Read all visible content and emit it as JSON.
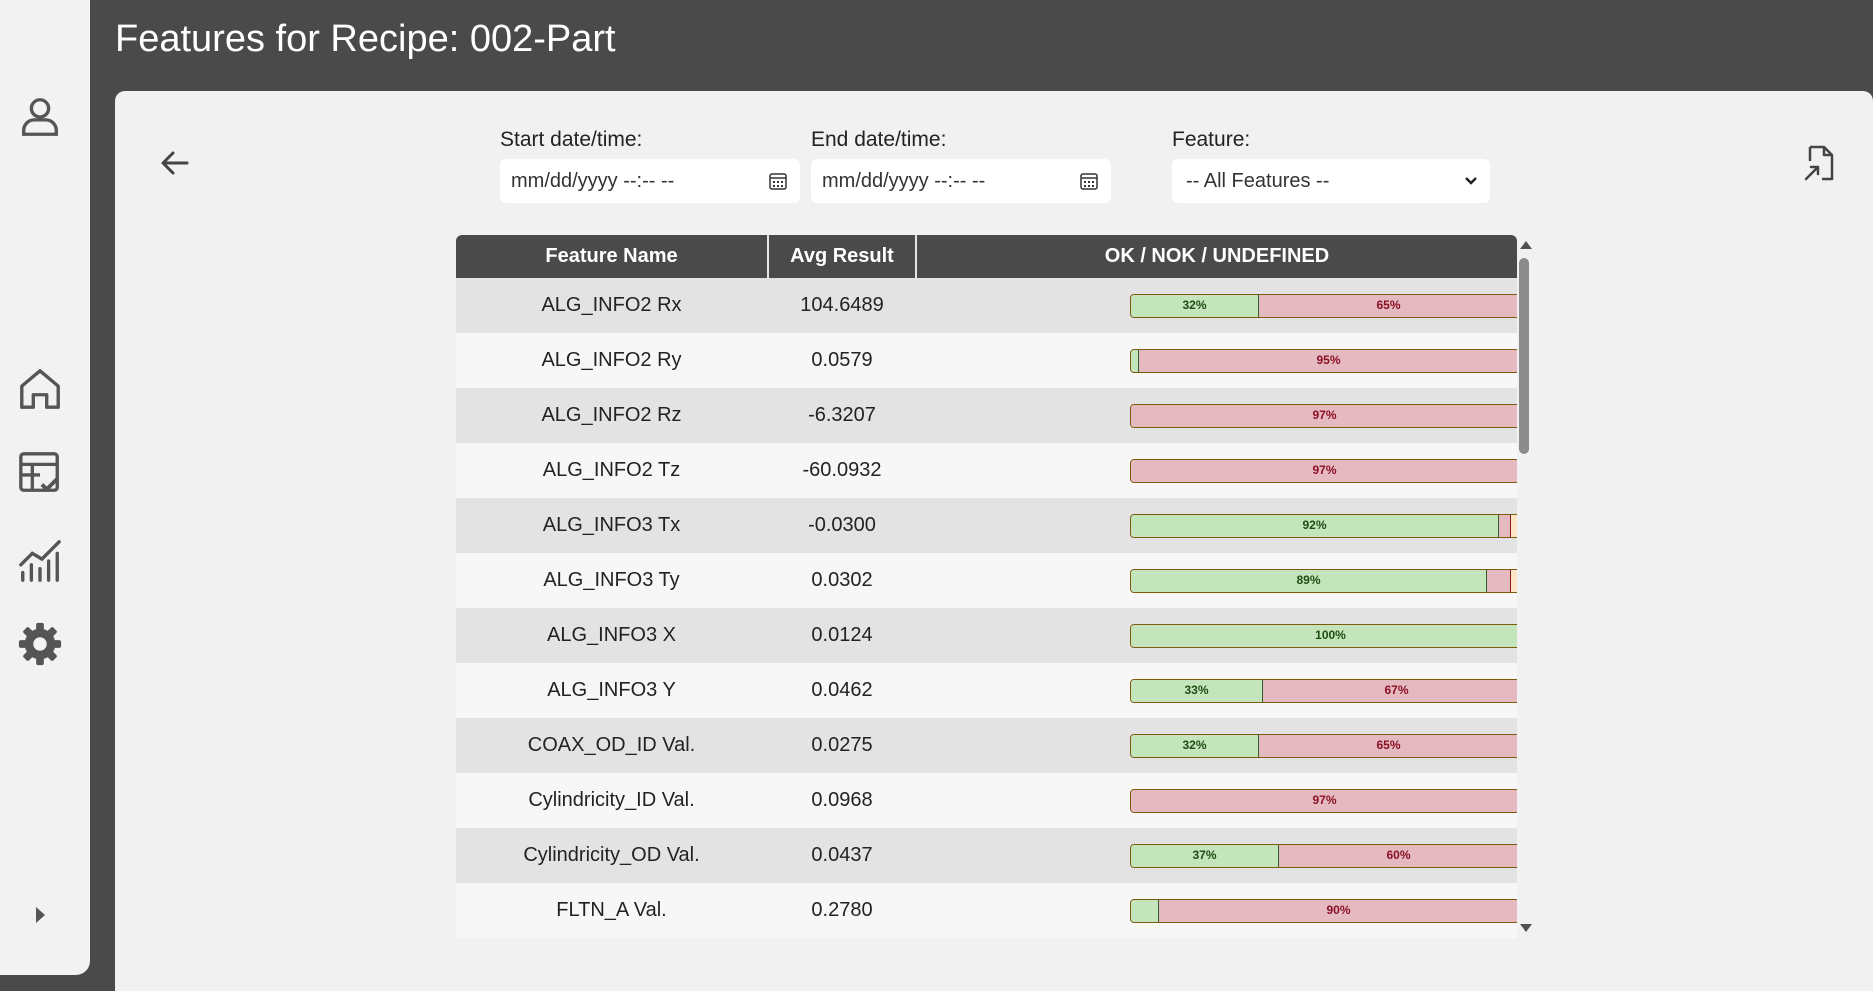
{
  "header": {
    "title": "Features for Recipe: 002-Part"
  },
  "sidebar": {
    "items": [
      {
        "name": "user-icon"
      },
      {
        "name": "home-icon"
      },
      {
        "name": "checklist-icon"
      },
      {
        "name": "chart-icon"
      },
      {
        "name": "settings-icon"
      },
      {
        "name": "expand-arrow-icon"
      }
    ]
  },
  "filters": {
    "start_label": "Start date/time:",
    "start_placeholder": "mm/dd/yyyy --:-- --",
    "end_label": "End date/time:",
    "end_placeholder": "mm/dd/yyyy --:-- --",
    "feature_label": "Feature:",
    "feature_selected": "-- All Features --"
  },
  "table": {
    "headers": [
      "Feature Name",
      "Avg Result",
      "OK / NOK / UNDEFINED"
    ],
    "rows": [
      {
        "name": "ALG_INFO2 Rx",
        "avg": "104.6489",
        "ok": 32,
        "nok": 65,
        "ok_label": "32%",
        "nok_label": "65%"
      },
      {
        "name": "ALG_INFO2 Ry",
        "avg": "0.0579",
        "ok": 2,
        "nok": 95,
        "ok_label": "",
        "nok_label": "95%"
      },
      {
        "name": "ALG_INFO2 Rz",
        "avg": "-6.3207",
        "ok": 0,
        "nok": 97,
        "ok_label": "",
        "nok_label": "97%"
      },
      {
        "name": "ALG_INFO2 Tz",
        "avg": "-60.0932",
        "ok": 0,
        "nok": 97,
        "ok_label": "",
        "nok_label": "97%"
      },
      {
        "name": "ALG_INFO3 Tx",
        "avg": "-0.0300",
        "ok": 92,
        "nok": 3,
        "ok_label": "92%",
        "nok_label": ""
      },
      {
        "name": "ALG_INFO3 Ty",
        "avg": "0.0302",
        "ok": 89,
        "nok": 6,
        "ok_label": "89%",
        "nok_label": ""
      },
      {
        "name": "ALG_INFO3 X",
        "avg": "0.0124",
        "ok": 100,
        "nok": 0,
        "ok_label": "100%",
        "nok_label": ""
      },
      {
        "name": "ALG_INFO3 Y",
        "avg": "0.0462",
        "ok": 33,
        "nok": 67,
        "ok_label": "33%",
        "nok_label": "67%"
      },
      {
        "name": "COAX_OD_ID Val.",
        "avg": "0.0275",
        "ok": 32,
        "nok": 65,
        "ok_label": "32%",
        "nok_label": "65%"
      },
      {
        "name": "Cylindricity_ID Val.",
        "avg": "0.0968",
        "ok": 0,
        "nok": 97,
        "ok_label": "",
        "nok_label": "97%"
      },
      {
        "name": "Cylindricity_OD Val.",
        "avg": "0.0437",
        "ok": 37,
        "nok": 60,
        "ok_label": "37%",
        "nok_label": "60%"
      },
      {
        "name": "FLTN_A Val.",
        "avg": "0.2780",
        "ok": 7,
        "nok": 90,
        "ok_label": "",
        "nok_label": "90%"
      }
    ]
  },
  "colors": {
    "ok_fill": "#c4e4bb",
    "nok_fill": "#e5b9c0",
    "undefined_fill": "#fbe6c5",
    "header_bg": "#4a4a4a"
  }
}
